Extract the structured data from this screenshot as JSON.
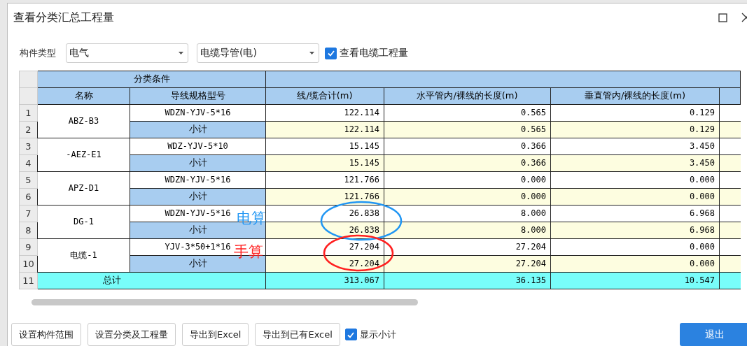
{
  "window": {
    "title": "查看分类汇总工程量"
  },
  "filter": {
    "label": "构件类型",
    "dropdowns": [
      "电气",
      "电缆导管(电)"
    ],
    "checkbox": {
      "label": "查看电缆工程量",
      "checked": true
    }
  },
  "table": {
    "group_header": "分类条件",
    "columns": [
      "名称",
      "导线规格型号",
      "线/缆合计(m)",
      "水平管内/裸线的长度(m)",
      "垂直管内/裸线的长度(m)"
    ],
    "groups": [
      {
        "name": "ABZ-B3",
        "rows": [
          {
            "kind": "item",
            "num": "1",
            "spec": "WDZN-YJV-5*16",
            "values": [
              "122.114",
              "0.565",
              "0.129"
            ]
          },
          {
            "kind": "subtotal",
            "num": "2",
            "spec": "小计",
            "values": [
              "122.114",
              "0.565",
              "0.129"
            ]
          }
        ]
      },
      {
        "name": "-AEZ-E1",
        "rows": [
          {
            "kind": "item",
            "num": "3",
            "spec": "WDZ-YJV-5*10",
            "values": [
              "15.145",
              "0.366",
              "3.450"
            ]
          },
          {
            "kind": "subtotal",
            "num": "4",
            "spec": "小计",
            "values": [
              "15.145",
              "0.366",
              "3.450"
            ]
          }
        ]
      },
      {
        "name": "APZ-D1",
        "rows": [
          {
            "kind": "item",
            "num": "5",
            "spec": "WDZN-YJV-5*16",
            "values": [
              "121.766",
              "0.000",
              "0.000"
            ]
          },
          {
            "kind": "subtotal",
            "num": "6",
            "spec": "小计",
            "values": [
              "121.766",
              "0.000",
              "0.000"
            ]
          }
        ]
      },
      {
        "name": "DG-1",
        "rows": [
          {
            "kind": "item",
            "num": "7",
            "spec": "WDZN-YJV-5*16",
            "values": [
              "26.838",
              "8.000",
              "6.968"
            ]
          },
          {
            "kind": "subtotal",
            "num": "8",
            "spec": "小计",
            "values": [
              "26.838",
              "8.000",
              "6.968"
            ]
          }
        ]
      },
      {
        "name": "电缆-1",
        "rows": [
          {
            "kind": "item",
            "num": "9",
            "spec": "YJV-3*50+1*16",
            "values": [
              "27.204",
              "27.204",
              "0.000"
            ]
          },
          {
            "kind": "subtotal",
            "num": "10",
            "spec": "小计",
            "values": [
              "27.204",
              "27.204",
              "0.000"
            ]
          }
        ]
      }
    ],
    "total": {
      "num": "11",
      "label": "总计",
      "values": [
        "313.067",
        "36.135",
        "10.547"
      ]
    }
  },
  "annotations": [
    {
      "text": "电算",
      "color": "#2196f3"
    },
    {
      "text": "手算",
      "color": "#ff2020"
    }
  ],
  "buttons": [
    "设置构件范围",
    "设置分类及工程量",
    "导出到Excel",
    "导出到已有Excel"
  ],
  "show_subtotal": {
    "label": "显示小计",
    "checked": true
  },
  "exit_button": "退出"
}
